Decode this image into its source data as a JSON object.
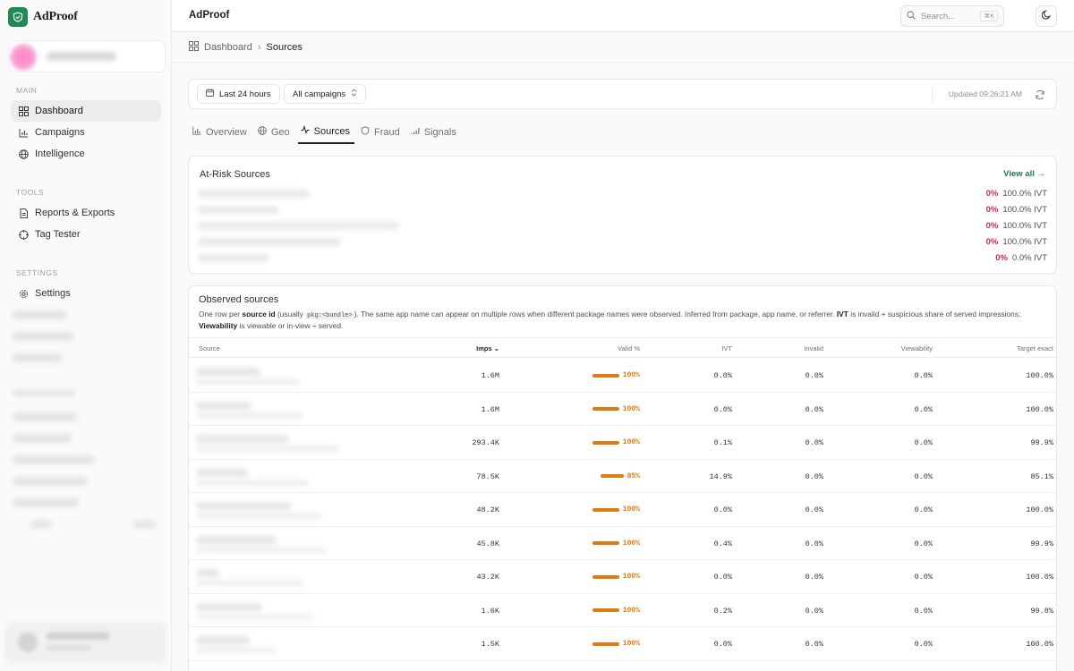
{
  "app": {
    "brand": "AdProof",
    "title": "AdProof"
  },
  "search": {
    "placeholder": "Search...",
    "shortcut": "⌘K"
  },
  "breadcrumb": {
    "parent": "Dashboard",
    "current": "Sources"
  },
  "sidebar": {
    "main_label": "MAIN",
    "main_items": [
      {
        "label": "Dashboard",
        "icon": "grid-icon"
      },
      {
        "label": "Campaigns",
        "icon": "bar-chart-icon"
      },
      {
        "label": "Intelligence",
        "icon": "globe-icon"
      }
    ],
    "tools_label": "TOOLS",
    "tools_items": [
      {
        "label": "Reports & Exports",
        "icon": "document-icon"
      },
      {
        "label": "Tag Tester",
        "icon": "target-icon"
      }
    ],
    "settings_label": "SETTINGS",
    "settings_items": [
      {
        "label": "Settings",
        "icon": "gear-icon"
      }
    ]
  },
  "filters": {
    "range": "Last 24 hours",
    "campaign": "All campaigns",
    "updated": "Updated 09:26:21 AM"
  },
  "tabs": [
    {
      "label": "Overview",
      "icon": "bar-chart-icon"
    },
    {
      "label": "Geo",
      "icon": "globe-icon"
    },
    {
      "label": "Sources",
      "icon": "activity-icon"
    },
    {
      "label": "Fraud",
      "icon": "shield-icon"
    },
    {
      "label": "Signals",
      "icon": "signal-icon"
    }
  ],
  "at_risk": {
    "title": "At-Risk Sources",
    "view_all": "View all →",
    "rows": [
      {
        "pct": "0%",
        "ivt": "100.0% IVT"
      },
      {
        "pct": "0%",
        "ivt": "100.0% IVT"
      },
      {
        "pct": "0%",
        "ivt": "100.0% IVT"
      },
      {
        "pct": "0%",
        "ivt": "100.0% IVT"
      },
      {
        "pct": "0%",
        "ivt": "0.0% IVT"
      }
    ]
  },
  "observed": {
    "title": "Observed sources",
    "desc_1": "One row per ",
    "desc_b1": "source id",
    "desc_2": " (usually ",
    "desc_code": "pkg:<bundle>",
    "desc_3": "). The same app name can appear on multiple rows when different package names were observed. Inferred from package, app name, or referrer. ",
    "desc_b2": "IVT",
    "desc_4": " is invalid + suspicious share of served impressions; ",
    "desc_b3": "Viewability",
    "desc_5": " is viewable or in-view ÷ served.",
    "columns": {
      "source": "Source",
      "imps": "Imps ⌄",
      "valid": "Valid %",
      "ivt": "IVT",
      "invalid": "Invalid",
      "viewability": "Viewability",
      "target": "Target exact"
    },
    "rows": [
      {
        "imps": "1.6M",
        "valid": "100%",
        "valid_frac": 1.0,
        "ivt": "0.0%",
        "invalid": "0.0%",
        "viewability": "0.0%",
        "target": "100.0%"
      },
      {
        "imps": "1.6M",
        "valid": "100%",
        "valid_frac": 1.0,
        "ivt": "0.0%",
        "invalid": "0.0%",
        "viewability": "0.0%",
        "target": "100.0%"
      },
      {
        "imps": "293.4K",
        "valid": "100%",
        "valid_frac": 1.0,
        "ivt": "0.1%",
        "invalid": "0.0%",
        "viewability": "0.0%",
        "target": "99.9%"
      },
      {
        "imps": "78.5K",
        "valid": "85%",
        "valid_frac": 0.85,
        "ivt": "14.9%",
        "invalid": "0.0%",
        "viewability": "0.0%",
        "target": "85.1%"
      },
      {
        "imps": "48.2K",
        "valid": "100%",
        "valid_frac": 1.0,
        "ivt": "0.0%",
        "invalid": "0.0%",
        "viewability": "0.0%",
        "target": "100.0%"
      },
      {
        "imps": "45.8K",
        "valid": "100%",
        "valid_frac": 1.0,
        "ivt": "0.4%",
        "invalid": "0.0%",
        "viewability": "0.0%",
        "target": "99.9%"
      },
      {
        "imps": "43.2K",
        "valid": "100%",
        "valid_frac": 1.0,
        "ivt": "0.0%",
        "invalid": "0.0%",
        "viewability": "0.0%",
        "target": "100.0%"
      },
      {
        "imps": "1.6K",
        "valid": "100%",
        "valid_frac": 1.0,
        "ivt": "0.2%",
        "invalid": "0.0%",
        "viewability": "0.0%",
        "target": "99.8%"
      },
      {
        "imps": "1.5K",
        "valid": "100%",
        "valid_frac": 1.0,
        "ivt": "0.0%",
        "invalid": "0.0%",
        "viewability": "0.0%",
        "target": "100.0%"
      }
    ]
  },
  "colors": {
    "accent": "#1f8a55",
    "danger": "#d42a44",
    "valid_bar": "#e07b10"
  }
}
